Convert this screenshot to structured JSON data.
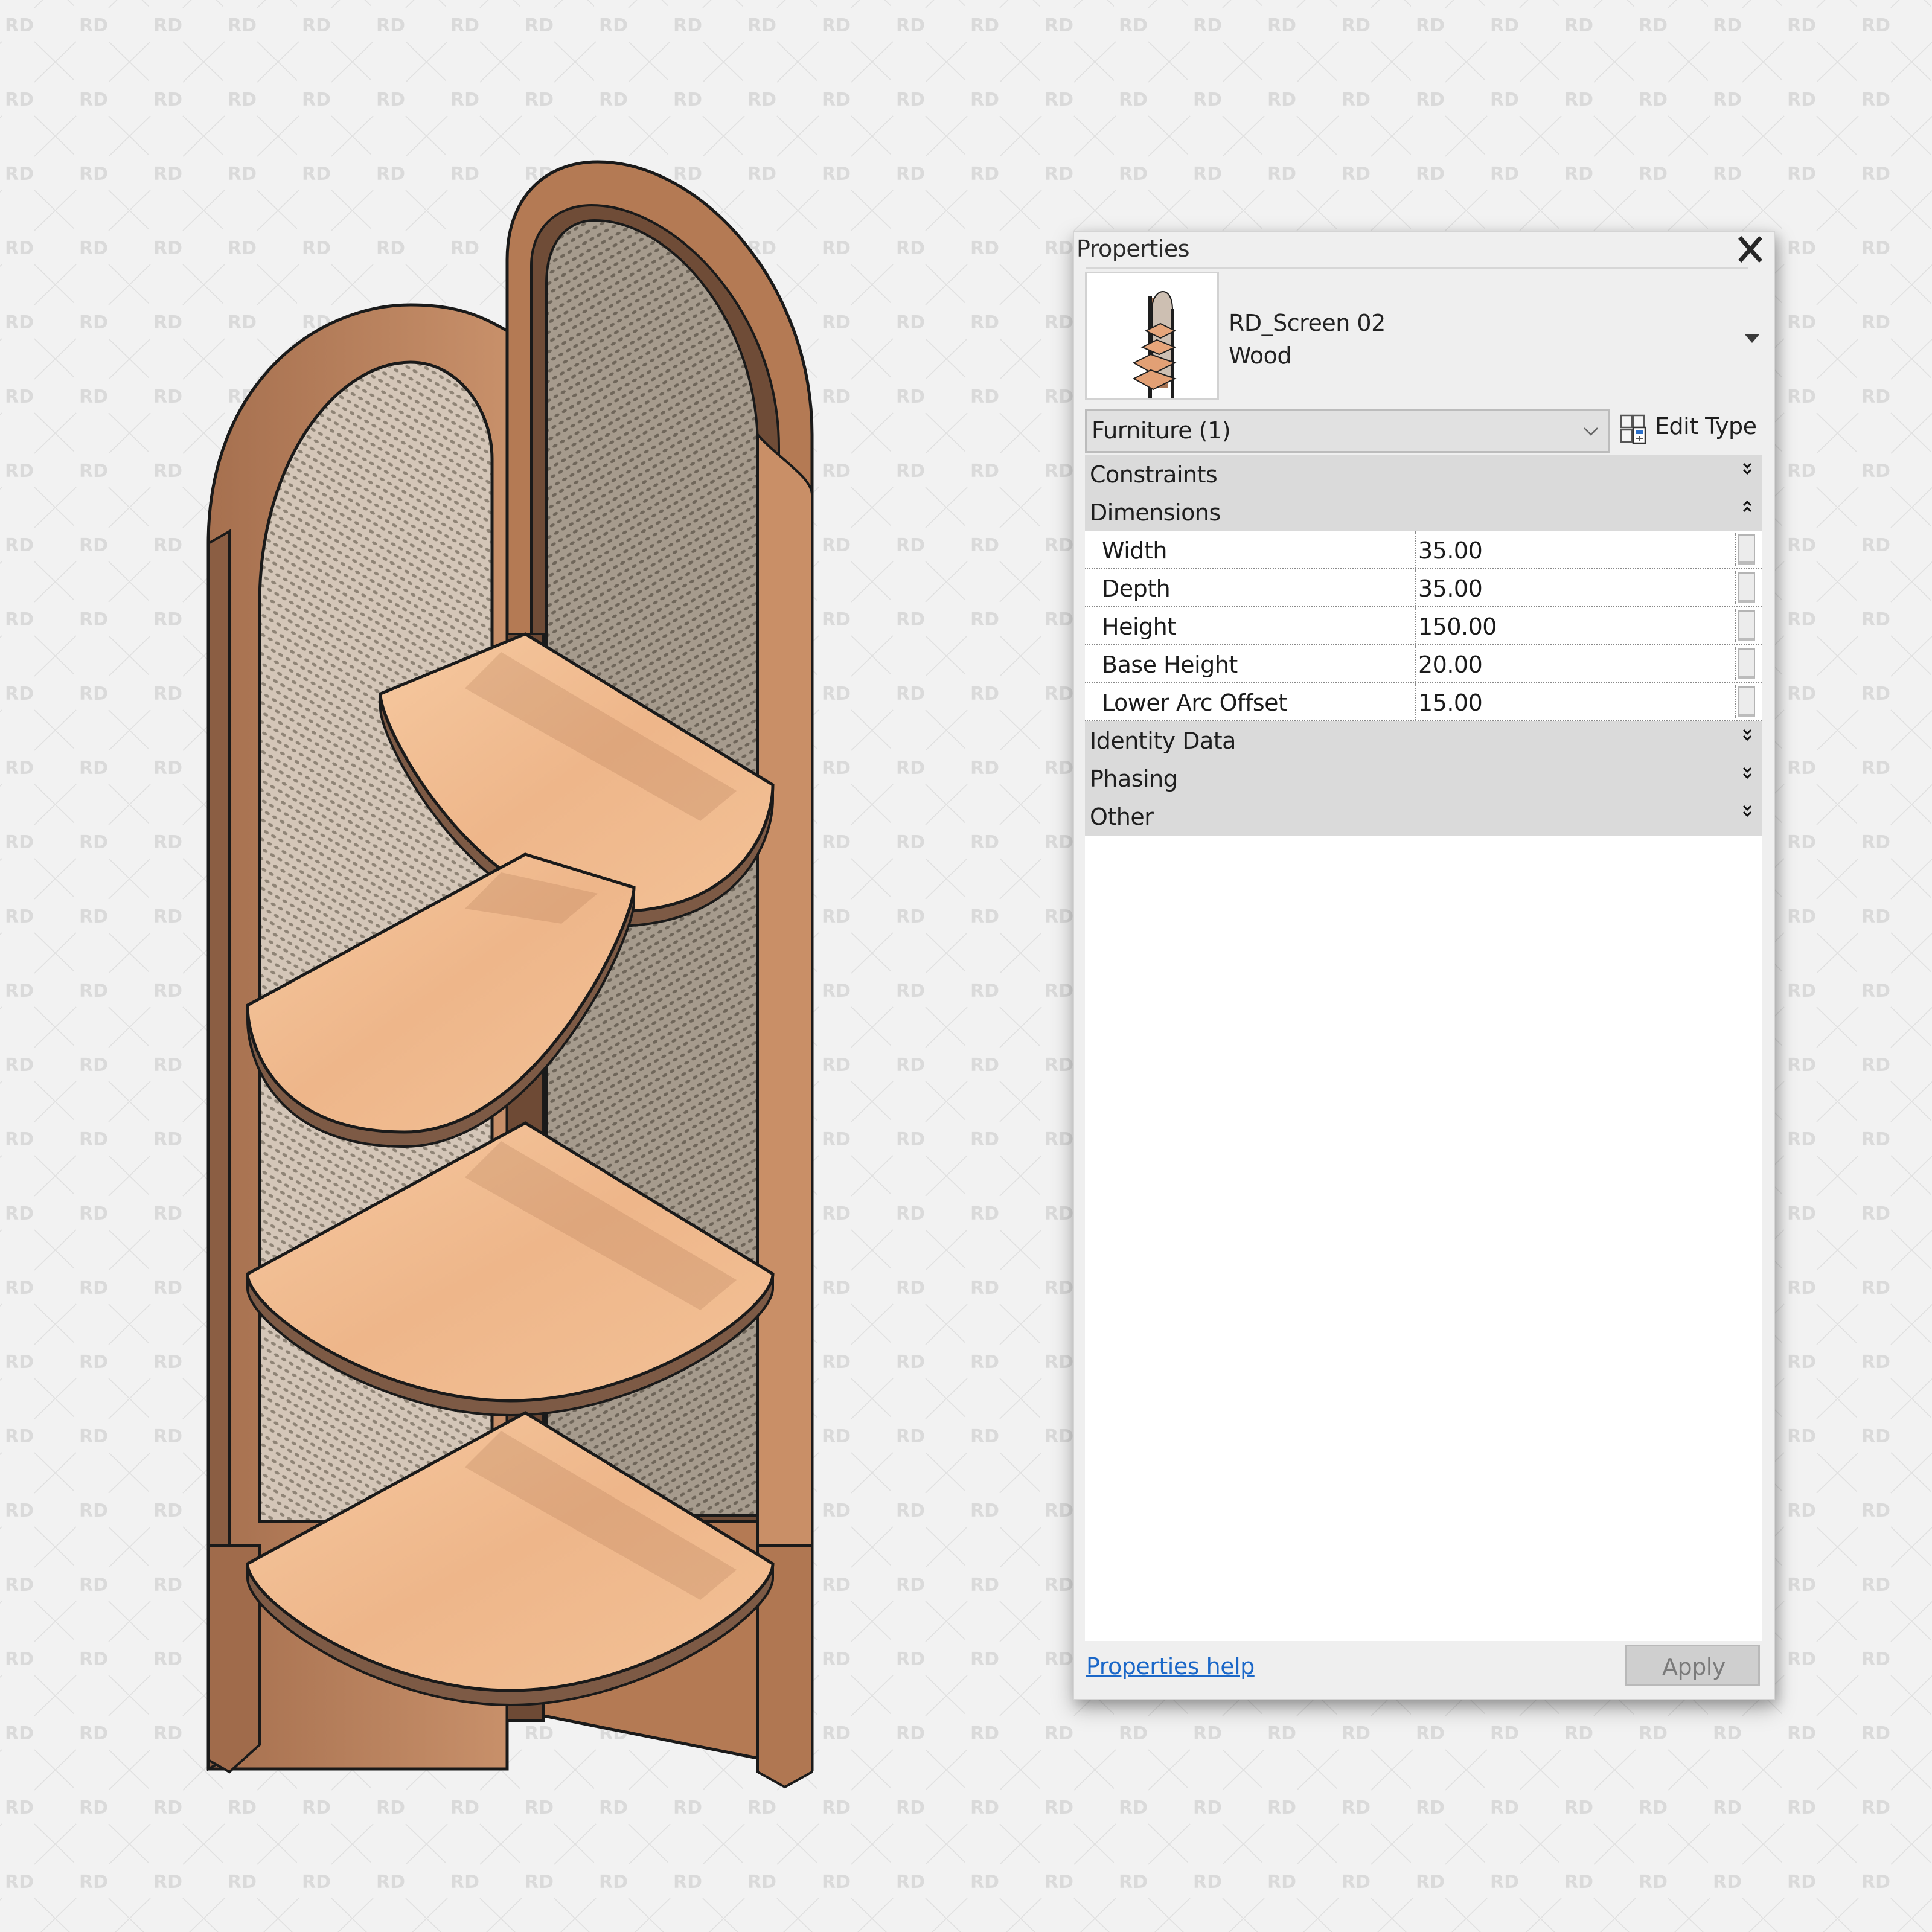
{
  "watermark": {
    "text": "RD",
    "color": "#dadada",
    "cross_color": "#e2e2e2"
  },
  "render": {
    "description": "Isometric 3D view of a corner shelf unit with two arched wood-framed cane panels and four quarter-round shelves",
    "colors": {
      "frame_front": "#b9825c",
      "frame_side": "#8b5e43",
      "frame_edge": "#d8a47c",
      "shelf_top": "#f2be92",
      "shelf_edge": "#7d5a45",
      "cane_light": "#cdbfb2",
      "cane_dark": "#8e8374",
      "outline": "#1a1a1a"
    },
    "shelf_count": 4
  },
  "properties_panel": {
    "title": "Properties",
    "close_label": "×",
    "type_selector": {
      "family": "RD_Screen 02",
      "type": "Wood"
    },
    "filter": {
      "selected": "Furniture (1)"
    },
    "edit_type_label": "Edit Type",
    "sections": [
      {
        "label": "Constraints",
        "expanded": false
      },
      {
        "label": "Dimensions",
        "expanded": true,
        "rows": [
          {
            "name": "Width",
            "value": "35.00"
          },
          {
            "name": "Depth",
            "value": "35.00"
          },
          {
            "name": "Height",
            "value": "150.00"
          },
          {
            "name": "Base Height",
            "value": "20.00"
          },
          {
            "name": "Lower Arc Offset",
            "value": "15.00"
          }
        ]
      },
      {
        "label": "Identity Data",
        "expanded": false
      },
      {
        "label": "Phasing",
        "expanded": false
      },
      {
        "label": "Other",
        "expanded": false
      }
    ],
    "help_link": "Properties help",
    "apply_label": "Apply",
    "colors": {
      "section_bg": "#dadada",
      "link": "#1a67c8",
      "apply_bg": "#cfcfcf"
    }
  }
}
